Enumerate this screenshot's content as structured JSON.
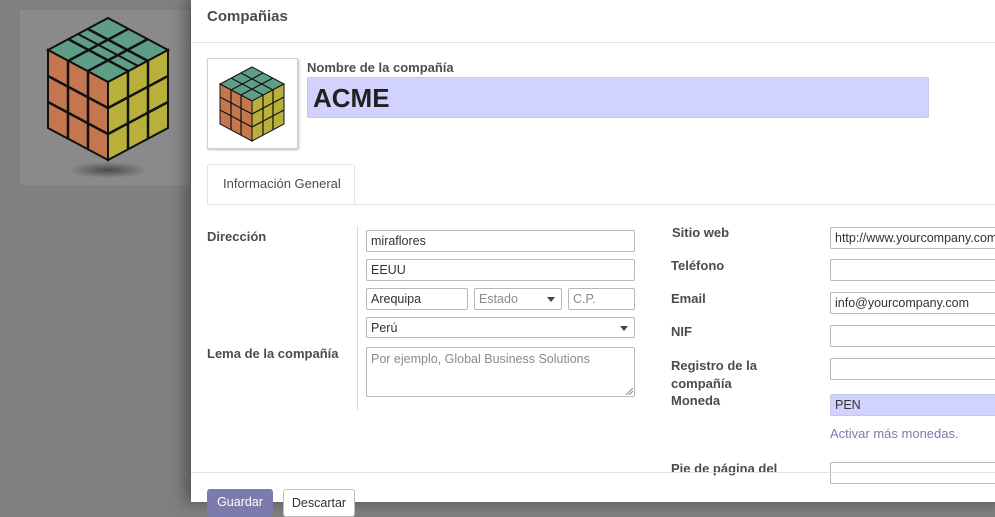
{
  "modal": {
    "title": "Compañias"
  },
  "company": {
    "name_label": "Nombre de la compañía",
    "name_value": "ACME"
  },
  "tabs": [
    {
      "label": "Información General"
    }
  ],
  "address": {
    "label": "Dirección",
    "street": "miraflores",
    "street2": "EEUU",
    "city": "Arequipa",
    "state_placeholder": "Estado",
    "zip_placeholder": "C.P.",
    "country": "Perú"
  },
  "tagline": {
    "label": "Lema de la compañía",
    "placeholder": "Por ejemplo, Global Business Solutions"
  },
  "right": {
    "website_label": "Sitio web",
    "website_value": "http://www.yourcompany.com",
    "phone_label": "Teléfono",
    "phone_value": "",
    "email_label": "Email",
    "email_value": "info@yourcompany.com",
    "vat_label": "NIF",
    "vat_value": "",
    "registry_label": "Registro de la compañía",
    "currency_label": "Moneda",
    "currency_value": "PEN",
    "currency_link": "Activar más monedas.",
    "footer_label": "Pie de página del"
  },
  "buttons": {
    "save": "Guardar",
    "discard": "Descartar"
  },
  "colors": {
    "primary": "#7c7bad",
    "highlight_input": "#d2d2ff"
  }
}
